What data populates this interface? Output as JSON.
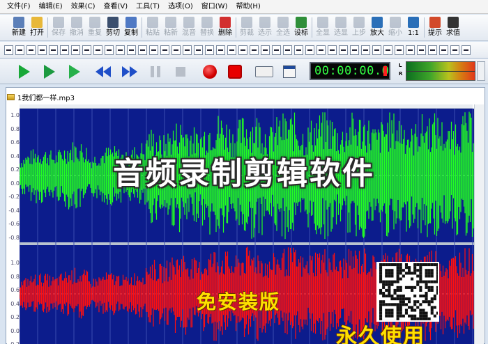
{
  "menu": [
    "文件(F)",
    "编辑(E)",
    "效果(C)",
    "查看(V)",
    "工具(T)",
    "选项(O)",
    "窗口(W)",
    "帮助(H)"
  ],
  "toolbar": [
    {
      "label": "新建",
      "icon": "new-file-icon",
      "color": "#5b7fb8",
      "disabled": false
    },
    {
      "label": "打开",
      "icon": "open-folder-icon",
      "color": "#e8b83a",
      "disabled": false
    },
    {
      "label": "保存",
      "icon": "save-icon",
      "color": "#7b8aa0",
      "disabled": true
    },
    {
      "label": "撤消",
      "icon": "undo-icon",
      "color": "#7b8aa0",
      "disabled": true
    },
    {
      "label": "重复",
      "icon": "redo-icon",
      "color": "#7b8aa0",
      "disabled": true
    },
    {
      "label": "剪切",
      "icon": "cut-icon",
      "color": "#3b4f6e",
      "disabled": false
    },
    {
      "label": "复制",
      "icon": "copy-icon",
      "color": "#4f79c4",
      "disabled": false
    },
    {
      "label": "粘贴",
      "icon": "paste-icon",
      "color": "#7b8aa0",
      "disabled": true
    },
    {
      "label": "粘新",
      "icon": "paste-new-icon",
      "color": "#7b8aa0",
      "disabled": true
    },
    {
      "label": "混音",
      "icon": "mix-paste-icon",
      "color": "#7b8aa0",
      "disabled": true
    },
    {
      "label": "替换",
      "icon": "replace-icon",
      "color": "#7b8aa0",
      "disabled": true
    },
    {
      "label": "删除",
      "icon": "delete-icon",
      "color": "#d23030",
      "disabled": false
    },
    {
      "label": "剪裁",
      "icon": "trim-icon",
      "color": "#7b8aa0",
      "disabled": true
    },
    {
      "label": "选示",
      "icon": "select-view-icon",
      "color": "#7b8aa0",
      "disabled": true
    },
    {
      "label": "全选",
      "icon": "select-all-icon",
      "color": "#7b8aa0",
      "disabled": true
    },
    {
      "label": "设标",
      "icon": "set-marker-icon",
      "color": "#2f8f3a",
      "disabled": false
    },
    {
      "label": "全显",
      "icon": "zoom-all-icon",
      "color": "#7b8aa0",
      "disabled": true
    },
    {
      "label": "选显",
      "icon": "zoom-selection-icon",
      "color": "#7b8aa0",
      "disabled": true
    },
    {
      "label": "上步",
      "icon": "previous-zoom-icon",
      "color": "#7b8aa0",
      "disabled": true
    },
    {
      "label": "放大",
      "icon": "zoom-in-icon",
      "color": "#2a6fb8",
      "disabled": false
    },
    {
      "label": "缩小",
      "icon": "zoom-out-icon",
      "color": "#7b8aa0",
      "disabled": true
    },
    {
      "label": "1:1",
      "icon": "zoom-1to1-icon",
      "color": "#2a6fb8",
      "disabled": false
    },
    {
      "label": "提示",
      "icon": "tips-icon",
      "color": "#d24a2a",
      "disabled": false
    },
    {
      "label": "求值",
      "icon": "fx-evaluate-icon",
      "color": "#333333",
      "disabled": false
    }
  ],
  "toolbar2_count": 42,
  "transport": {
    "time": "00:00:00.0",
    "meter_left": "L",
    "meter_right": "R"
  },
  "document": {
    "tab_title": "1我们都一样.mp3"
  },
  "amplitude_labels": [
    "1.0",
    "0.8",
    "0.6",
    "0.4",
    "0.2",
    "0.0",
    "-0.2",
    "-0.4",
    "-0.6",
    "-0.8"
  ],
  "overlay": {
    "title": "音频录制剪辑软件",
    "subtitle1": "免安装版",
    "subtitle2": "永久使用"
  },
  "colors": {
    "channel_bg": "#0c1c8c",
    "left_wave": "#22ff22",
    "right_wave": "#ff1010",
    "accent_yellow": "#ffe000"
  }
}
